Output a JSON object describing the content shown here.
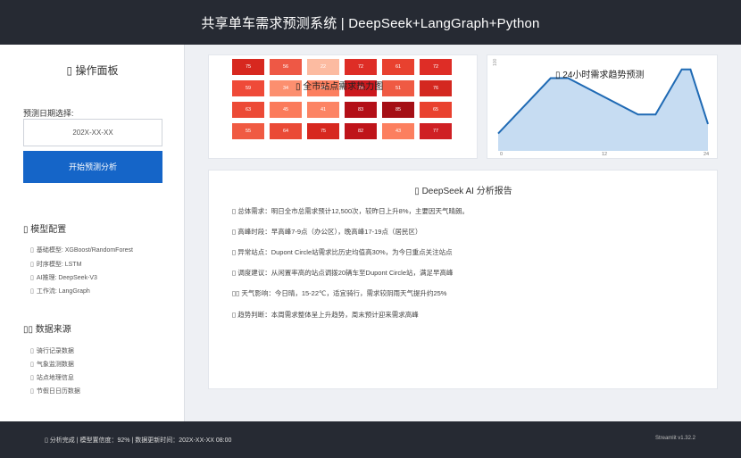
{
  "header": {
    "title": "共享单车需求预测系统 | DeepSeek+LangGraph+Python"
  },
  "sidebar": {
    "title": "▯ 操作面板",
    "date_label": "预测日期选择:",
    "date_value": "202X-XX-XX",
    "run_button": "开始预测分析",
    "model_section": "▯ 模型配置",
    "model_items": [
      "基础模型: XGBoost/RandomForest",
      "时序模型: LSTM",
      "AI推理: DeepSeek-V3",
      "工作流: LangGraph"
    ],
    "data_section": "▯▯ 数据来源",
    "data_items": [
      "骑行记录数据",
      "气象监测数据",
      "站点地理信息",
      "节假日日历数据"
    ]
  },
  "heatmap": {
    "title": "▯ 全市站点需求热力图",
    "rows": [
      [
        75,
        56,
        22,
        72,
        61,
        72
      ],
      [
        59,
        34,
        43,
        78,
        51,
        76
      ],
      [
        63,
        45,
        41,
        83,
        85,
        65
      ],
      [
        55,
        64,
        75,
        82,
        43,
        77
      ]
    ],
    "colors": [
      [
        "#d7281f",
        "#ee5845",
        "#fcbba1",
        "#de2d26",
        "#e8412f",
        "#de2d26"
      ],
      [
        "#ef4a38",
        "#fc8f6f",
        "#fc7f5f",
        "#cb181d",
        "#ef5a43",
        "#d42820"
      ],
      [
        "#ec4a36",
        "#fb7b5b",
        "#fc8464",
        "#b30f17",
        "#a50f15",
        "#e9412f"
      ],
      [
        "#f05a42",
        "#ea4a36",
        "#d7281f",
        "#bf141a",
        "#fc7f5f",
        "#cf2024"
      ]
    ]
  },
  "trend": {
    "title": "▯ 24小时需求趋势预测",
    "y_tick": "100",
    "x_ticks": [
      "0",
      "12",
      "24"
    ],
    "color": "#1f6ab4"
  },
  "chart_data": {
    "type": "area",
    "title": "24小时需求趋势预测",
    "x": [
      0,
      6,
      8,
      16,
      18,
      21,
      22,
      24
    ],
    "values": [
      20,
      84,
      84,
      42,
      42,
      94,
      94,
      31
    ],
    "xlim": [
      0,
      24
    ],
    "ylim": [
      0,
      100
    ]
  },
  "report": {
    "title": "▯ DeepSeek AI 分析报告",
    "lines": [
      "▯ 总体需求：明日全市总需求预计12,500次，较昨日上升8%，主要因天气晴朗。",
      "▯ 高峰时段：早高峰7-9点（办公区），晚高峰17-19点（居民区）",
      "▯ 异常站点：Dupont Circle站需求比历史均值高30%，为今日重点关注站点",
      "▯ 调度建议：从闲置率高的站点调拨20辆车至Dupont Circle站，满足早高峰",
      "▯▯ 天气影响：今日晴，15-22℃，适宜骑行，需求较阴雨天气提升约25%",
      "▯ 趋势判断：本周需求整体呈上升趋势，周末预计迎来需求高峰"
    ]
  },
  "footer": {
    "status": "▯ 分析完成 | 模型置信度：92% | 数据更新时间：202X-XX-XX 08:00",
    "version": "Streamlit v1.32.2"
  }
}
